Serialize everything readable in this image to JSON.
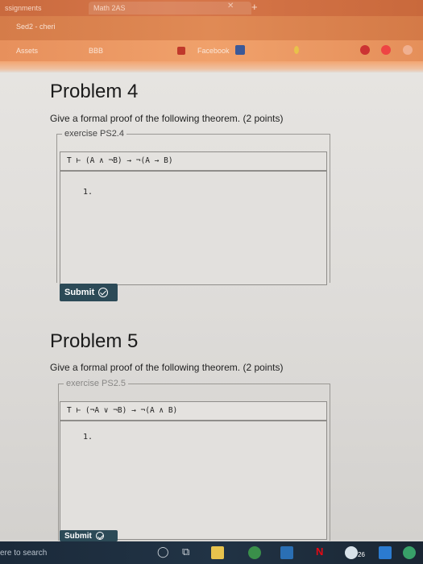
{
  "browser": {
    "tabs": [
      {
        "label": "ssignments"
      },
      {
        "label": "Math 2AS"
      }
    ],
    "address": "Sed2 - cheri",
    "bookmarks": [
      "Assets",
      "BBB",
      "Facebook",
      "",
      "",
      ""
    ]
  },
  "problems": [
    {
      "title": "Problem 4",
      "description": "Give a formal proof of the following theorem. (2 points)",
      "exercise": "exercise PS2.4",
      "statement": "T ⊢ (A ∧ ¬B) → ¬(A → B)",
      "line": "1.",
      "submit_label": "Submit"
    },
    {
      "title": "Problem 5",
      "description": "Give a formal proof of the following theorem. (2 points)",
      "exercise": "exercise PS2.5",
      "statement": "T ⊢ (¬A ∨ ¬B) → ¬(A ∧ B)",
      "line": "1.",
      "submit_label": "Submit"
    }
  ],
  "taskbar": {
    "search_text": "ere to search",
    "icons": [
      "cortana-icon",
      "task-view-icon",
      "file-explorer-icon",
      "chrome-icon",
      "store-icon",
      "netflix-icon",
      "mail-icon",
      "photos-icon",
      "calendar-icon",
      "edge-icon"
    ],
    "badge": "26"
  },
  "colors": {
    "submit": "#2c4a57",
    "chrome": "#e08a55"
  }
}
